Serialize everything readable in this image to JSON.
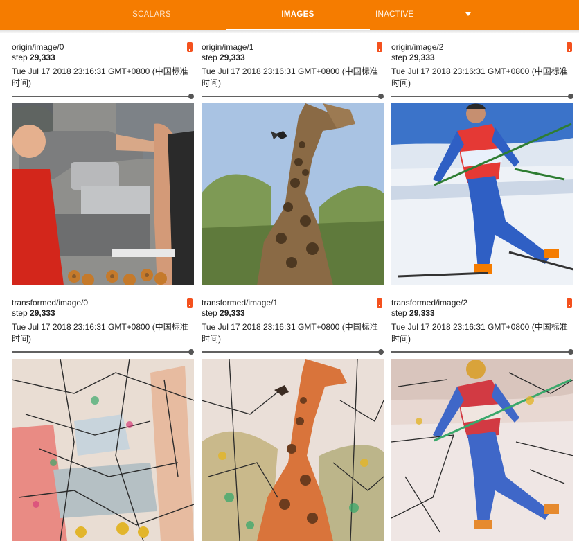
{
  "nav": {
    "tabs": [
      {
        "label": "SCALARS",
        "active": false
      },
      {
        "label": "IMAGES",
        "active": true
      }
    ],
    "inactive_select": {
      "value": "INACTIVE"
    }
  },
  "colors": {
    "topbar": "#f57c00",
    "badge": "#f4511e"
  },
  "cards": [
    {
      "name": "origin/image/0",
      "step_label": "step",
      "step_value": "29,333",
      "time": "Tue Jul 17 2018 23:16:31 GMT+0800 (中国标准时间)",
      "image": "donut-vendor-photo"
    },
    {
      "name": "origin/image/1",
      "step_label": "step",
      "step_value": "29,333",
      "time": "Tue Jul 17 2018 23:16:31 GMT+0800 (中国标准时间)",
      "image": "giraffe-photo"
    },
    {
      "name": "origin/image/2",
      "step_label": "step",
      "step_value": "29,333",
      "time": "Tue Jul 17 2018 23:16:31 GMT+0800 (中国标准时间)",
      "image": "cross-country-skier-photo"
    },
    {
      "name": "transformed/image/0",
      "step_label": "step",
      "step_value": "29,333",
      "time": "Tue Jul 17 2018 23:16:31 GMT+0800 (中国标准时间)",
      "image": "stylized-donut-vendor"
    },
    {
      "name": "transformed/image/1",
      "step_label": "step",
      "step_value": "29,333",
      "time": "Tue Jul 17 2018 23:16:31 GMT+0800 (中国标准时间)",
      "image": "stylized-giraffe"
    },
    {
      "name": "transformed/image/2",
      "step_label": "step",
      "step_value": "29,333",
      "time": "Tue Jul 17 2018 23:16:31 GMT+0800 (中国标准时间)",
      "image": "stylized-skier"
    }
  ]
}
